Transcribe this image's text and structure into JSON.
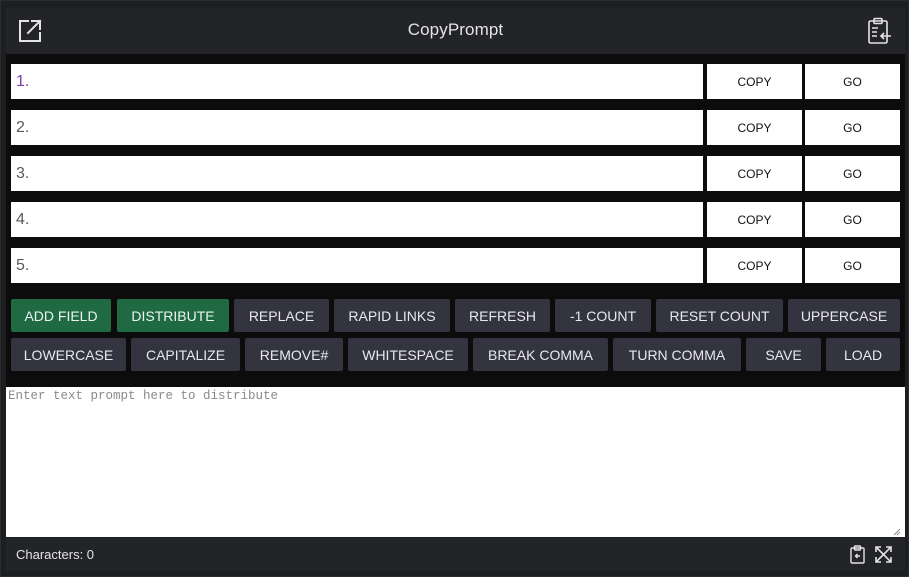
{
  "app": {
    "title": "CopyPrompt"
  },
  "fields": [
    {
      "placeholder": "1.",
      "copy_label": "COPY",
      "go_label": "GO"
    },
    {
      "placeholder": "2.",
      "copy_label": "COPY",
      "go_label": "GO"
    },
    {
      "placeholder": "3.",
      "copy_label": "COPY",
      "go_label": "GO"
    },
    {
      "placeholder": "4.",
      "copy_label": "COPY",
      "go_label": "GO"
    },
    {
      "placeholder": "5.",
      "copy_label": "COPY",
      "go_label": "GO"
    }
  ],
  "toolbar": {
    "row1": [
      "ADD FIELD",
      "DISTRIBUTE",
      "REPLACE",
      "RAPID LINKS",
      "REFRESH",
      "-1 COUNT",
      "RESET COUNT",
      "UPPERCASE"
    ],
    "row2": [
      "LOWERCASE",
      "CAPITALIZE",
      "REMOVE#",
      "WHITESPACE",
      "BREAK COMMA",
      "TURN COMMA",
      "SAVE",
      "LOAD"
    ]
  },
  "prompt": {
    "placeholder": "Enter text prompt here to distribute",
    "value": ""
  },
  "footer": {
    "characters_label": "Characters: 0"
  },
  "colors": {
    "accent_green": "#1f6a43",
    "button_dark": "#33343f",
    "background": "#1d1e20",
    "panel": "#0c0c0c"
  },
  "icons": {
    "popout": "external-link-icon",
    "paste_in": "clipboard-import-icon",
    "paste": "clipboard-icon",
    "expand": "expand-arrows-icon"
  }
}
